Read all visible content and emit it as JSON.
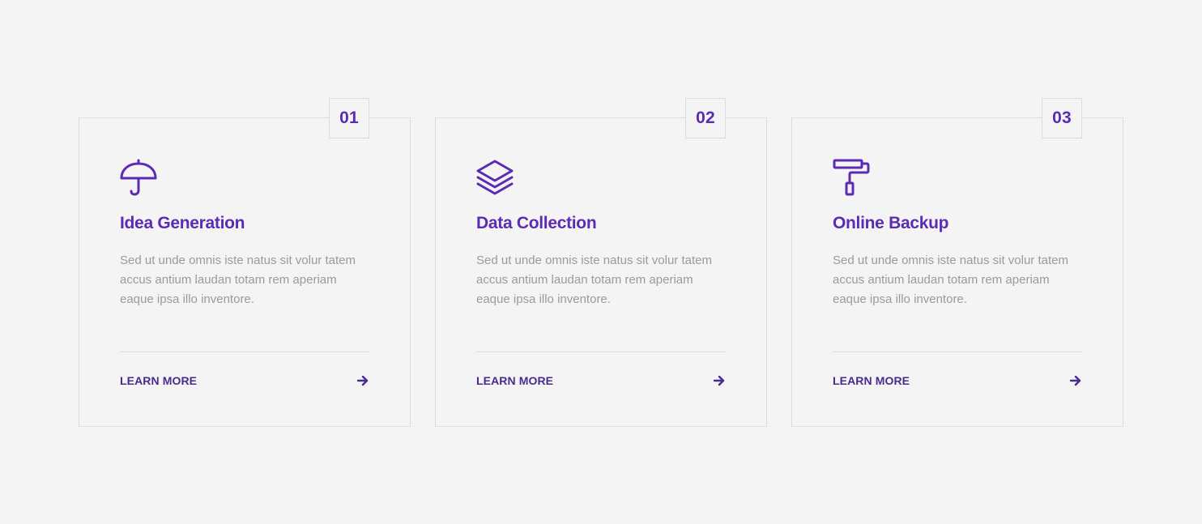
{
  "theme": {
    "accent": "#5b2bb5",
    "link_color": "#4a2a8f",
    "text_muted": "#9a9a9a",
    "border": "#dcdcdc",
    "background": "#f4f4f4"
  },
  "cards": [
    {
      "number": "01",
      "icon": "umbrella-icon",
      "title": "Idea Generation",
      "text": "Sed ut unde omnis iste natus sit volur tatem accus antium laudan totam rem aperiam eaque ipsa illo inventore.",
      "link_label": "LEARN MORE",
      "link_icon": "arrow-right-icon"
    },
    {
      "number": "02",
      "icon": "layers-icon",
      "title": "Data Collection",
      "text": "Sed ut unde omnis iste natus sit volur tatem accus antium laudan totam rem aperiam eaque ipsa illo inventore.",
      "link_label": "LEARN MORE",
      "link_icon": "arrow-right-icon"
    },
    {
      "number": "03",
      "icon": "paint-roller-icon",
      "title": "Online Backup",
      "text": "Sed ut unde omnis iste natus sit volur tatem accus antium laudan totam rem aperiam eaque ipsa illo inventore.",
      "link_label": "LEARN MORE",
      "link_icon": "arrow-right-icon"
    }
  ]
}
